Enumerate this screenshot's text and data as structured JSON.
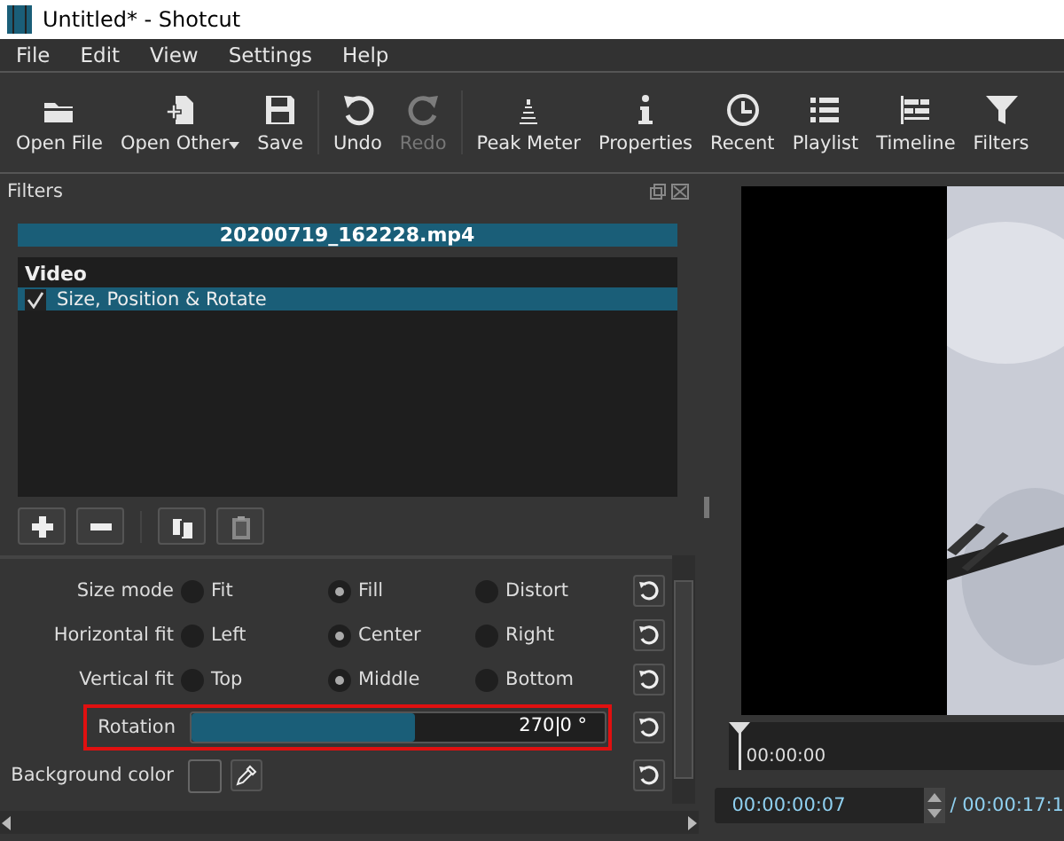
{
  "window": {
    "title": "Untitled* - Shotcut"
  },
  "menu": [
    "File",
    "Edit",
    "View",
    "Settings",
    "Help"
  ],
  "toolbar": [
    {
      "label": "Open File",
      "kind": "folder",
      "disabled": false,
      "dropdown": false
    },
    {
      "label": "Open Other",
      "kind": "openother",
      "disabled": false,
      "dropdown": true
    },
    {
      "label": "Save",
      "kind": "save",
      "disabled": false,
      "dropdown": false
    },
    {
      "label": "Undo",
      "kind": "undo",
      "disabled": false,
      "dropdown": false
    },
    {
      "label": "Redo",
      "kind": "redo",
      "disabled": true,
      "dropdown": false
    },
    {
      "label": "Peak Meter",
      "kind": "meter",
      "disabled": false,
      "dropdown": false
    },
    {
      "label": "Properties",
      "kind": "info",
      "disabled": false,
      "dropdown": false
    },
    {
      "label": "Recent",
      "kind": "clock",
      "disabled": false,
      "dropdown": false
    },
    {
      "label": "Playlist",
      "kind": "list",
      "disabled": false,
      "dropdown": false
    },
    {
      "label": "Timeline",
      "kind": "timeline",
      "disabled": false,
      "dropdown": false
    },
    {
      "label": "Filters",
      "kind": "filter",
      "disabled": false,
      "dropdown": false
    }
  ],
  "filters_panel": {
    "title": "Filters",
    "clip": "20200719_162228.mp4",
    "section": "Video",
    "filters": [
      {
        "name": "Size, Position & Rotate",
        "checked": true,
        "selected": true
      }
    ],
    "buttons": [
      {
        "kind": "add"
      },
      {
        "kind": "remove"
      },
      {
        "kind": "copy"
      },
      {
        "kind": "paste"
      }
    ],
    "options": [
      {
        "label": "Size mode",
        "choices": [
          {
            "label": "Fit",
            "selected": false
          },
          {
            "label": "Fill",
            "selected": true
          },
          {
            "label": "Distort",
            "selected": false
          }
        ]
      },
      {
        "label": "Horizontal fit",
        "choices": [
          {
            "label": "Left",
            "selected": false
          },
          {
            "label": "Center",
            "selected": true
          },
          {
            "label": "Right",
            "selected": false
          }
        ]
      },
      {
        "label": "Vertical fit",
        "choices": [
          {
            "label": "Top",
            "selected": false
          },
          {
            "label": "Middle",
            "selected": true
          },
          {
            "label": "Bottom",
            "selected": false
          }
        ]
      }
    ],
    "rotation": {
      "label": "Rotation",
      "level": 0.54,
      "value": "270",
      "value_rest": "0 °"
    },
    "background": {
      "label": "Background color"
    }
  },
  "player": {
    "ruler_time": "00:00:00",
    "position": "00:00:00:07",
    "duration": "/ 00:00:17:1"
  }
}
